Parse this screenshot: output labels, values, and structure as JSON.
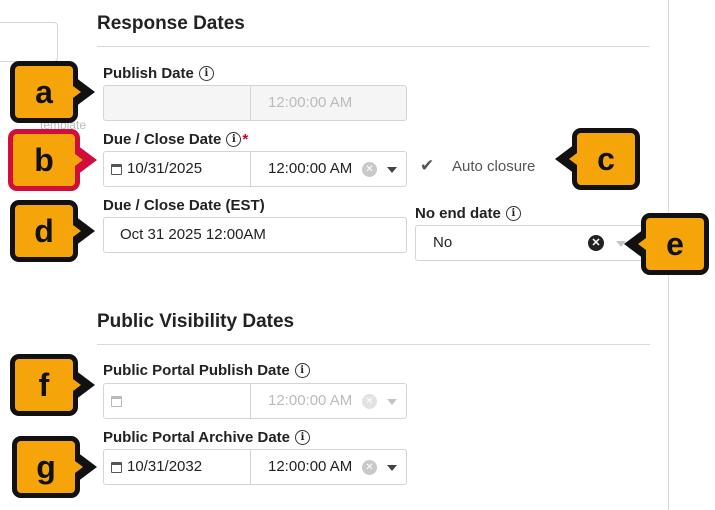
{
  "background_ghost_text": "template",
  "sections": {
    "response_dates": "Response Dates",
    "public_visibility_dates": "Public Visibility Dates"
  },
  "publish_date": {
    "label": "Publish Date",
    "date": "",
    "time": "12:00:00 AM",
    "disabled": true
  },
  "due_close_date": {
    "label": "Due / Close Date",
    "required_marker": "*",
    "date": "10/31/2025",
    "time": "12:00:00 AM"
  },
  "auto_closure": {
    "label": "Auto closure",
    "checked": true
  },
  "due_close_date_est": {
    "label": "Due / Close Date (EST)",
    "value": "Oct 31 2025 12:00AM"
  },
  "no_end_date": {
    "label": "No end date",
    "value": "No"
  },
  "public_portal_publish_date": {
    "label": "Public Portal Publish Date",
    "date": "",
    "time": "12:00:00 AM",
    "disabled": true
  },
  "public_portal_archive_date": {
    "label": "Public Portal Archive Date",
    "date": "10/31/2032",
    "time": "12:00:00 AM"
  },
  "callouts": {
    "a": "a",
    "b": "b",
    "c": "c",
    "d": "d",
    "e": "e",
    "f": "f",
    "g": "g"
  },
  "icons": {
    "info": "info-icon",
    "calendar": "calendar-icon",
    "clear": "clear-icon",
    "dropdown": "chevron-down-icon",
    "check": "checkmark-icon"
  },
  "colors": {
    "callout_fill": "#f5a50a",
    "callout_border": "#111111",
    "callout_highlight_border": "#d10d3c",
    "required": "#d0021b"
  }
}
